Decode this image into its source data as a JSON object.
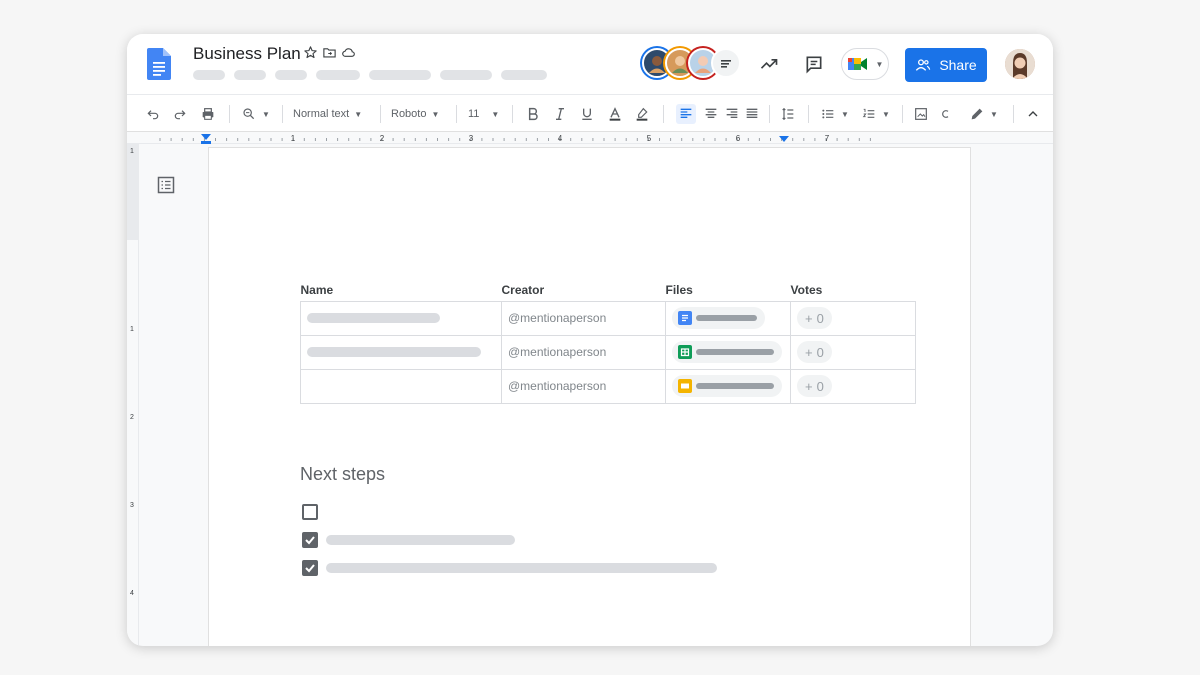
{
  "doc": {
    "title": "Business Plan"
  },
  "header": {
    "share_label": "Share",
    "colors": {
      "accent": "#1a73e8",
      "docs_blue": "#4285f4"
    }
  },
  "toolbar": {
    "style_select": "Normal text",
    "font_select": "Roboto",
    "size_select": "11"
  },
  "ruler": {
    "numbers": [
      "1",
      "2",
      "3",
      "4",
      "5",
      "6",
      "7"
    ],
    "vertical_numbers": [
      "1",
      "2",
      "3",
      "4"
    ]
  },
  "table": {
    "headers": [
      "Name",
      "Creator",
      "Files",
      "Votes"
    ],
    "rows": [
      {
        "creator": "@mentionaperson",
        "file_icon": "docs-icon",
        "votes": "0"
      },
      {
        "creator": "@mentionaperson",
        "file_icon": "sheets-icon",
        "votes": "0"
      },
      {
        "creator": "@mentionaperson",
        "file_icon": "slides-icon",
        "votes": "0"
      }
    ]
  },
  "next_steps": {
    "heading": "Next steps",
    "items": [
      {
        "checked": false
      },
      {
        "checked": true
      },
      {
        "checked": true
      }
    ]
  }
}
